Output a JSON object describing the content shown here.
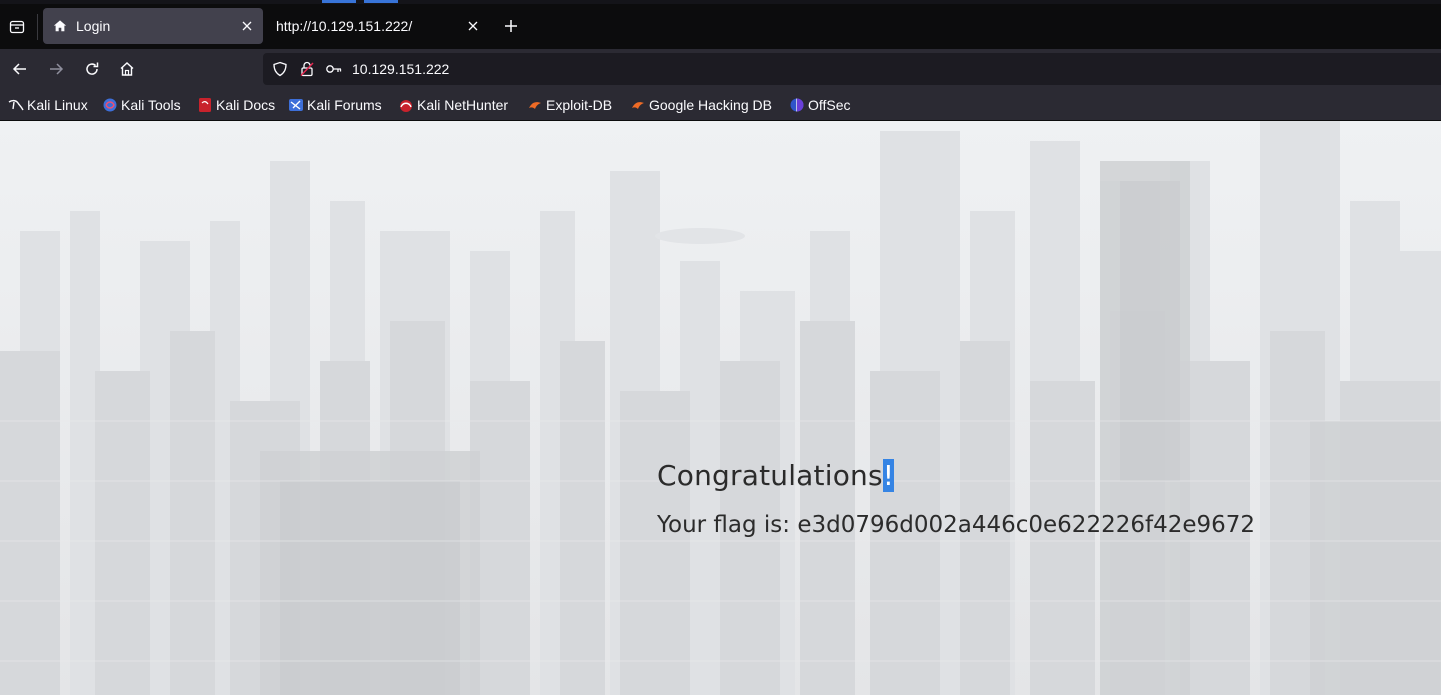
{
  "tabs": [
    {
      "label": "Login",
      "icon": "home-icon",
      "active": true
    },
    {
      "label": "http://10.129.151.222/",
      "icon": "",
      "active": false
    }
  ],
  "address_bar": {
    "url": "10.129.151.222"
  },
  "bookmarks": [
    {
      "label": "Kali Linux",
      "icon": "kali-dragon-icon"
    },
    {
      "label": "Kali Tools",
      "icon": "kali-tools-icon"
    },
    {
      "label": "Kali Docs",
      "icon": "kali-docs-icon"
    },
    {
      "label": "Kali Forums",
      "icon": "kali-forums-icon"
    },
    {
      "label": "Kali NetHunter",
      "icon": "nethunter-icon"
    },
    {
      "label": "Exploit-DB",
      "icon": "exploit-db-icon"
    },
    {
      "label": "Google Hacking DB",
      "icon": "ghdb-icon"
    },
    {
      "label": "OffSec",
      "icon": "offsec-icon"
    }
  ],
  "page": {
    "heading": "Congratulations",
    "heading_selected": "!",
    "flag_text": "Your flag is: e3d0796d002a446c0e622226f42e9672"
  },
  "colors": {
    "tabbar_bg": "#0c0c0d",
    "toolbar_bg": "#2b2a33",
    "urlbar_bg": "#1c1b22",
    "selection": "#3584e4"
  }
}
